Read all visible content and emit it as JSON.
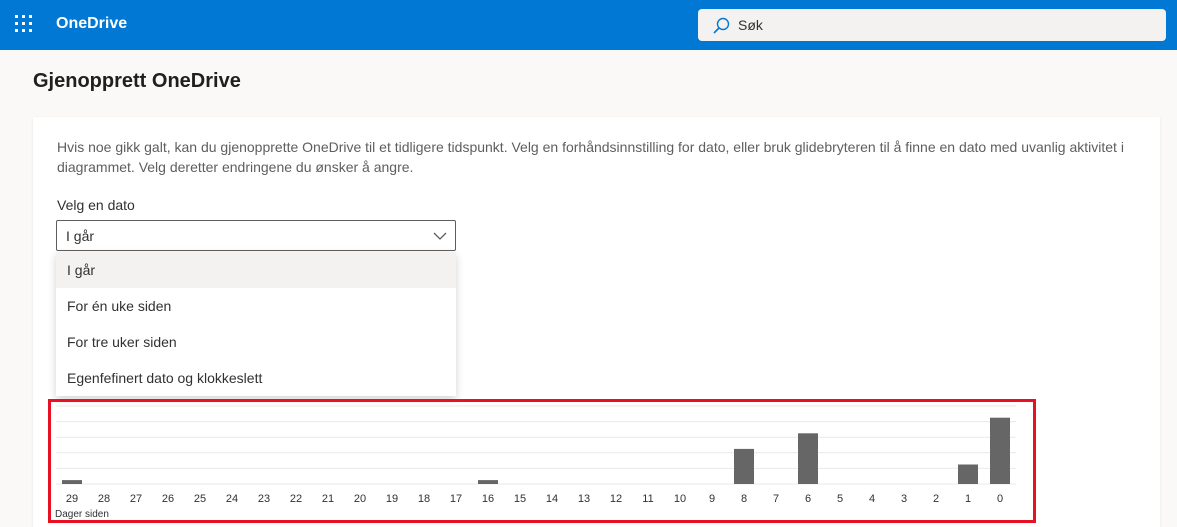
{
  "app": {
    "name": "OneDrive"
  },
  "search": {
    "placeholder": "Søk"
  },
  "page": {
    "title": "Gjenopprett OneDrive",
    "description": "Hvis noe gikk galt, kan du gjenopprette OneDrive til et tidligere tidspunkt. Velg en forhåndsinnstilling for dato, eller bruk glidebryteren til å finne en dato med uvanlig aktivitet i diagrammet. Velg deretter endringene du ønsker å angre."
  },
  "date_select": {
    "label": "Velg en dato",
    "selected": "I går",
    "options": [
      "I går",
      "For én uke siden",
      "For tre uker siden",
      "Egenfefinert dato og klokkeslett"
    ]
  },
  "colors": {
    "accent": "#0078d4",
    "bar": "#666666",
    "highlight": "#e81123"
  },
  "chart_data": {
    "type": "bar",
    "xlabel": "Dager siden",
    "categories": [
      "29",
      "28",
      "27",
      "26",
      "25",
      "24",
      "23",
      "22",
      "21",
      "20",
      "19",
      "18",
      "17",
      "16",
      "15",
      "14",
      "13",
      "12",
      "11",
      "10",
      "9",
      "8",
      "7",
      "6",
      "5",
      "4",
      "3",
      "2",
      "1",
      "0"
    ],
    "values": [
      1,
      0,
      0,
      0,
      0,
      0,
      0,
      0,
      0,
      0,
      0,
      0,
      0,
      1,
      0,
      0,
      0,
      0,
      0,
      0,
      0,
      9,
      0,
      13,
      0,
      0,
      0,
      0,
      5,
      17
    ],
    "ylim": [
      0,
      20
    ],
    "grid": true
  }
}
